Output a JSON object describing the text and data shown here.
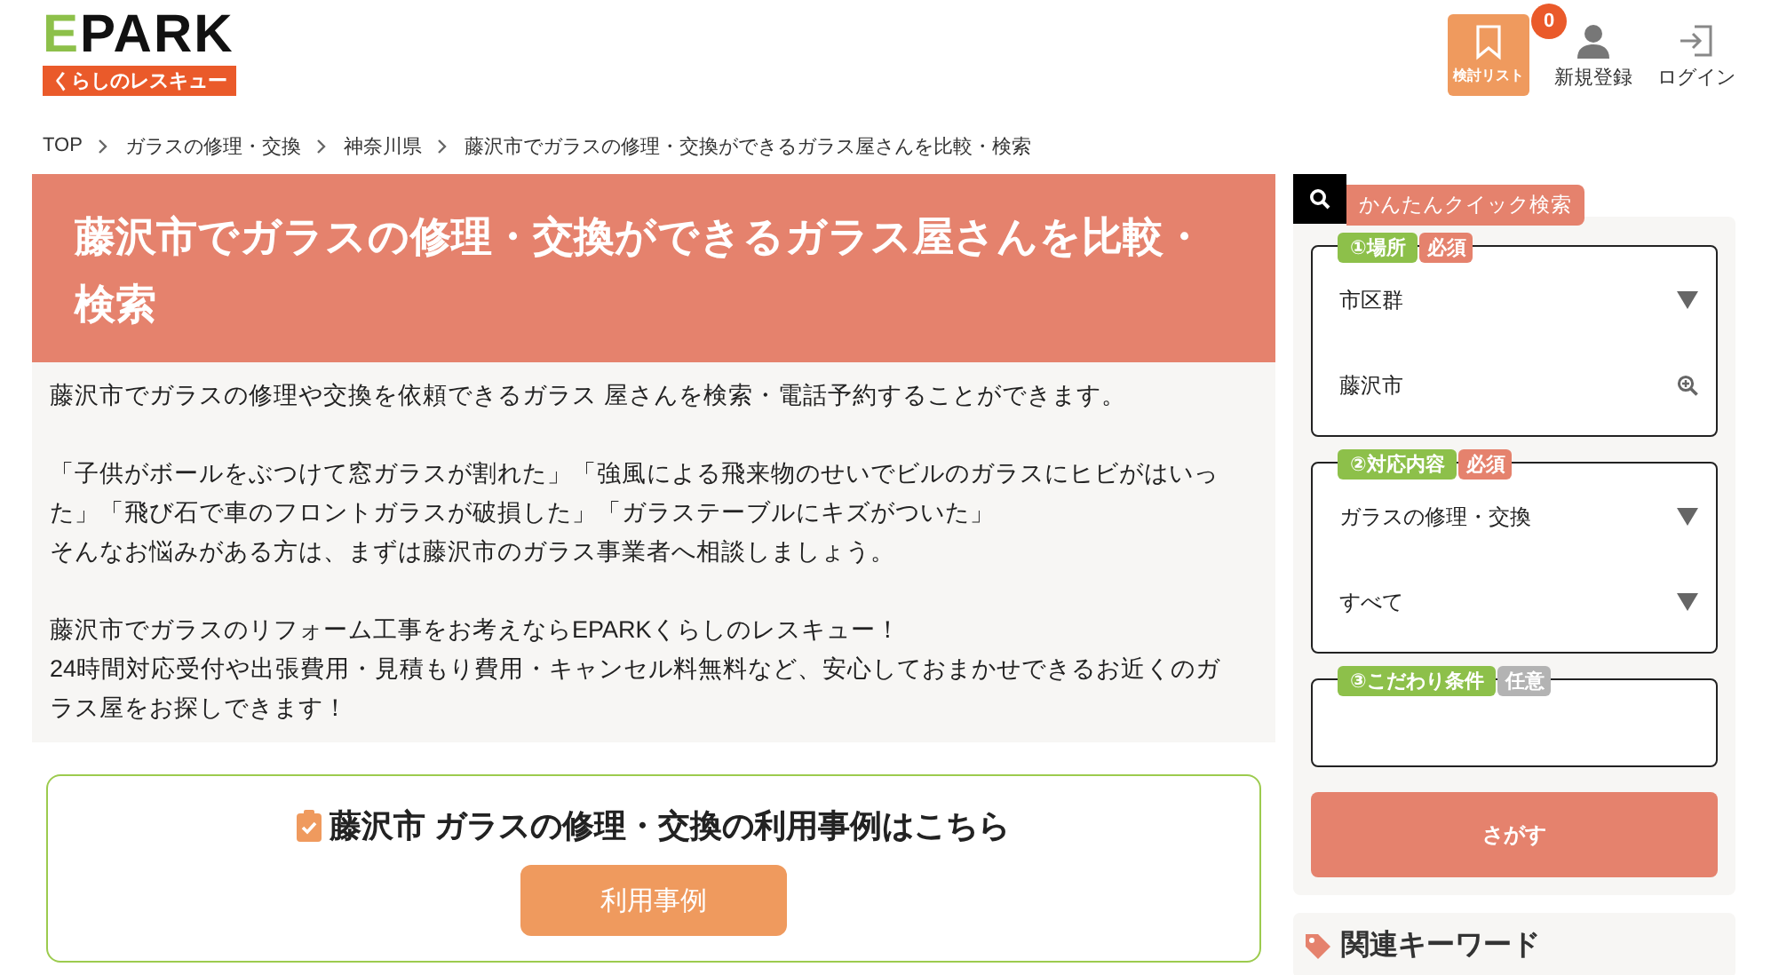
{
  "header": {
    "logo": "EPARK",
    "logo_sub": "くらしのレスキュー",
    "actions": [
      {
        "kind": "list",
        "label": "検討リスト",
        "badge": "0"
      },
      {
        "kind": "register",
        "label": "新規登録"
      },
      {
        "kind": "login",
        "label": "ログイン"
      }
    ]
  },
  "breadcrumb": [
    "TOP",
    "ガラスの修理・交換",
    "神奈川県",
    "藤沢市でガラスの修理・交換ができるガラス屋さんを比較・検索"
  ],
  "page_title": [
    "藤沢市でガラスの修理・交換ができるガラス屋さんを比較・",
    "検索"
  ],
  "intro": [
    [
      "藤沢市でガラスの修理や交換を依頼できるガラス 屋さんを検索・電話予約することができます。"
    ],
    [
      "「子供がボールをぶつけて窓ガラスが割れた」「強風による飛来物のせいでビルのガラスにヒビがはいっ",
      "た」「飛び石で車のフロントガラスが破損した」「ガラステーブルにキズがついた」",
      "そんなお悩みがある方は、まずは藤沢市のガラス事業者へ相談しましょう。"
    ],
    [
      "藤沢市でガラスのリフォーム工事をお考えならEPARKくらしのレスキュー！",
      "24時間対応受付や出張費用・見積もり費用・キャンセル料無料など、安心しておまかせできるお近くのガ",
      "ラス屋をお探しできます！"
    ]
  ],
  "case_box": {
    "heading": "藤沢市 ガラスの修理・交換の利用事例はこちら",
    "button": "利用事例"
  },
  "quick_search": {
    "title": "かんたんクイック検索",
    "groups": [
      {
        "label": "①場所",
        "tag": "必須",
        "required": true,
        "fields": [
          {
            "kind": "select",
            "value": "市区群"
          },
          {
            "kind": "search",
            "value": "藤沢市"
          }
        ]
      },
      {
        "label": "②対応内容",
        "tag": "必須",
        "required": true,
        "fields": [
          {
            "kind": "select",
            "value": "ガラスの修理・交換"
          },
          {
            "kind": "select",
            "value": "すべて"
          }
        ]
      },
      {
        "label": "③こだわり条件",
        "tag": "任意",
        "required": false
      }
    ],
    "button": "さがす"
  },
  "keywords": {
    "title": "関連キーワード"
  }
}
